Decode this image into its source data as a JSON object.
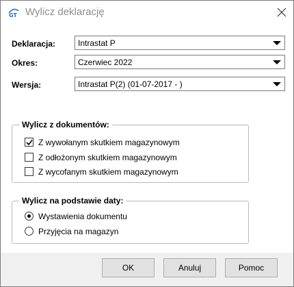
{
  "window": {
    "title": "Wylicz deklarację",
    "app_icon": "app-logo-icon",
    "close_icon": "close-icon"
  },
  "fields": {
    "deklaracja": {
      "label": "Deklaracja:",
      "value": "Intrastat P"
    },
    "okres": {
      "label": "Okres:",
      "value": "Czerwiec 2022"
    },
    "wersja": {
      "label": "Wersja:",
      "value": "Intrastat P(2) (01-07-2017 - )"
    }
  },
  "documents_group": {
    "title": "Wylicz z dokumentów:",
    "options": [
      {
        "label": "Z wywołanym skutkiem magazynowym",
        "checked": true
      },
      {
        "label": "Z odłożonym skutkiem magazynowym",
        "checked": false
      },
      {
        "label": "Z wycofanym skutkiem magazynowym",
        "checked": false
      }
    ]
  },
  "date_group": {
    "title": "Wylicz na podstawie daty:",
    "options": [
      {
        "label": "Wystawienia dokumentu",
        "selected": true
      },
      {
        "label": "Przyjęcia na magazyn",
        "selected": false
      }
    ]
  },
  "buttons": {
    "ok": "OK",
    "cancel": "Anuluj",
    "help": "Pomoc"
  }
}
